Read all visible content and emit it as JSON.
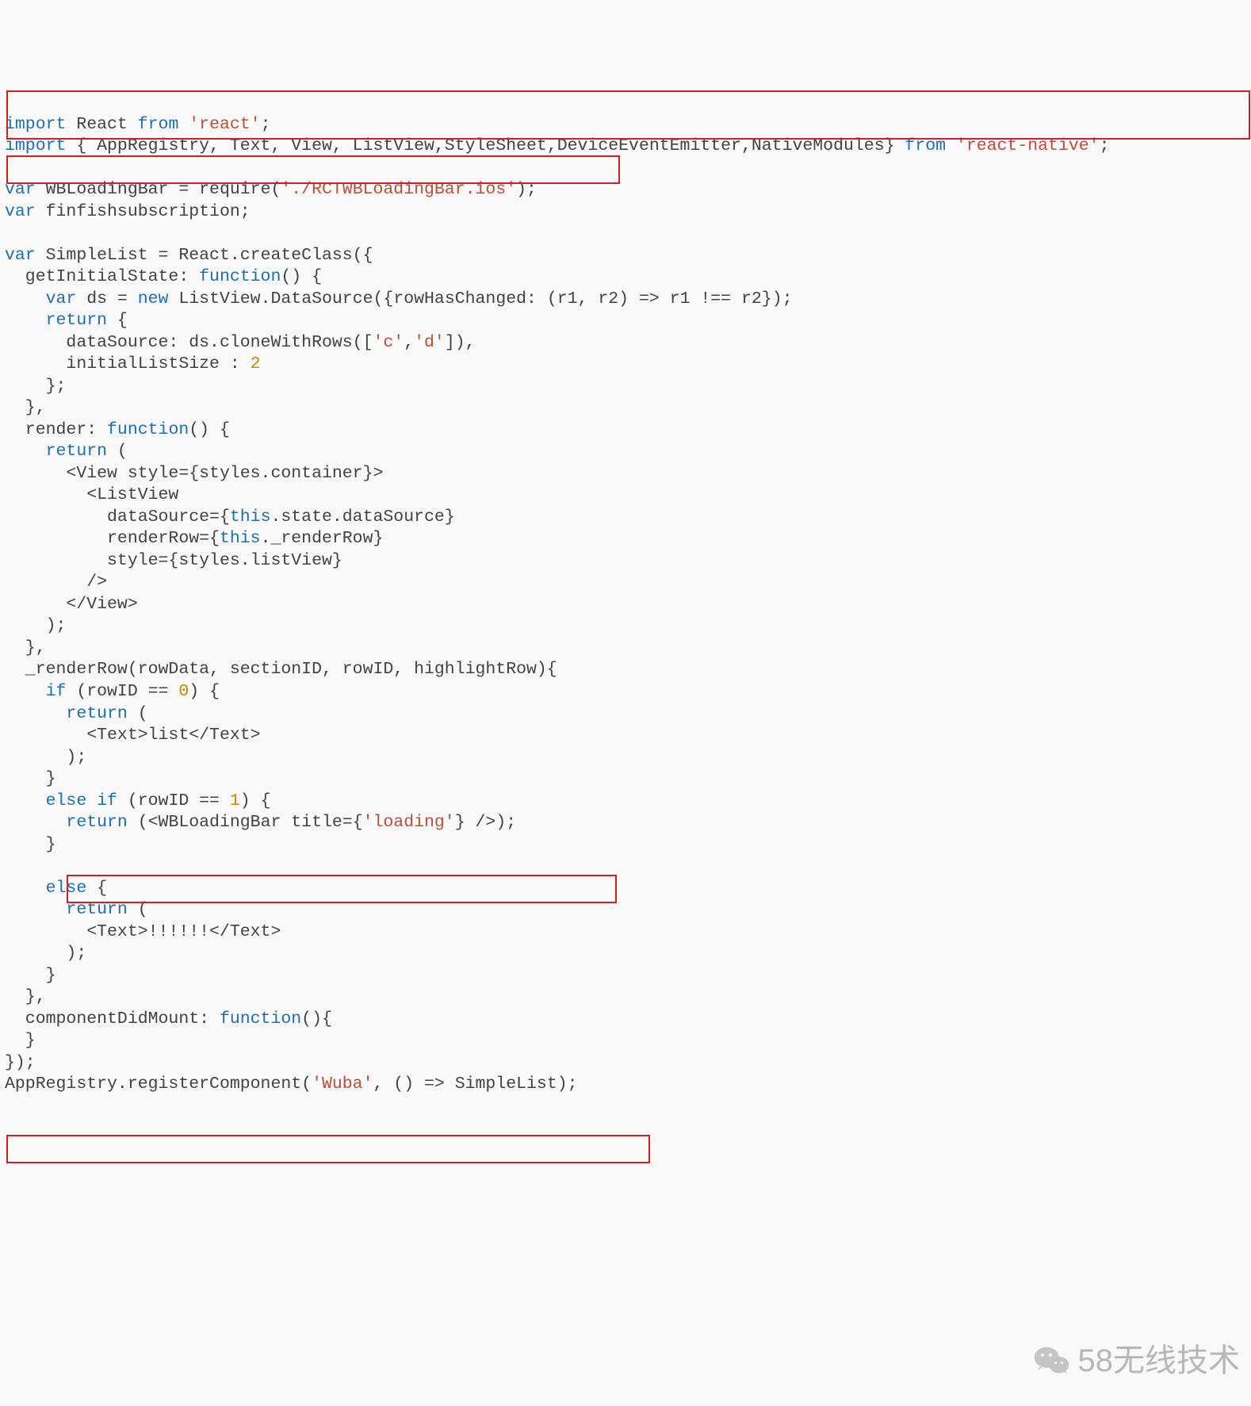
{
  "code": {
    "t": {
      "import": "import",
      "from": "from",
      "var": "var",
      "new": "new",
      "return": "return",
      "function": "function",
      "if": "if",
      "else": "else",
      "elseif": "else if",
      "this": "this"
    },
    "s": {
      "react": "'react'",
      "reactnative": "'react-native'",
      "rctwb": "'./RCTWBLoadingBar.ios'",
      "c": "'c'",
      "d": "'d'",
      "loading": "'loading'",
      "wuba": "'Wuba'"
    },
    "n": {
      "zero": "0",
      "one": "1",
      "two": "2"
    },
    "plain": {
      "l1a": " React ",
      "l1b": " ",
      "l1c": ";",
      "l2a": " { AppRegistry, Text, View, ListView,StyleSheet,DeviceEventEmitter,NativeModules} ",
      "l2b": " ",
      "l2c": ";",
      "l4a": " WBLoadingBar = require(",
      "l4b": ");",
      "l5a": " finfishsubscription;",
      "l7a": " SimpleList = React.createClass({",
      "l8a": "  getInitialState: ",
      "l8b": "() {",
      "l9a": "    ",
      "l9b": " ds = ",
      "l9c": " ListView.DataSource({rowHasChanged: (r1, r2) => r1 !== r2});",
      "l10a": "    ",
      "l10b": " {",
      "l11a": "      dataSource: ds.cloneWithRows([",
      "l11b": ",",
      "l11c": "]),",
      "l12a": "      initialListSize : ",
      "l13a": "    };",
      "l14a": "  },",
      "l15a": "  render: ",
      "l15b": "() {",
      "l16a": "    ",
      "l16b": " (",
      "l17a": "      <View style={styles.container}>",
      "l18a": "        <ListView",
      "l19a": "          dataSource={",
      "l19b": ".state.dataSource}",
      "l20a": "          renderRow={",
      "l20b": "._renderRow}",
      "l21a": "          style={styles.listView}",
      "l22a": "        />",
      "l23a": "      </View>",
      "l24a": "    );",
      "l25a": "  },",
      "l26a": "  _renderRow(rowData, sectionID, rowID, highlightRow){",
      "l27a": "    ",
      "l27b": " (rowID == ",
      "l27c": ") {",
      "l28a": "      ",
      "l28b": " (",
      "l29a": "        <Text>list</Text>",
      "l30a": "      );",
      "l31a": "    }",
      "l32a": "    ",
      "l32b": " (rowID == ",
      "l32c": ") {",
      "l33a": "      ",
      "l33b": " (<WBLoadingBar title={",
      "l33c": "} />);",
      "l34a": "    }",
      "l36a": "    ",
      "l36b": " {",
      "l37a": "      ",
      "l37b": " (",
      "l38a": "        <Text>!!!!!!</Text>",
      "l39a": "      );",
      "l40a": "    }",
      "l41a": "  },",
      "l42a": "  componentDidMount: ",
      "l42b": "(){",
      "l43a": "  }",
      "l44a": "});",
      "l45a": "AppRegistry.registerComponent(",
      "l45b": ", () => SimpleList);"
    }
  },
  "watermark": "58无线技术"
}
